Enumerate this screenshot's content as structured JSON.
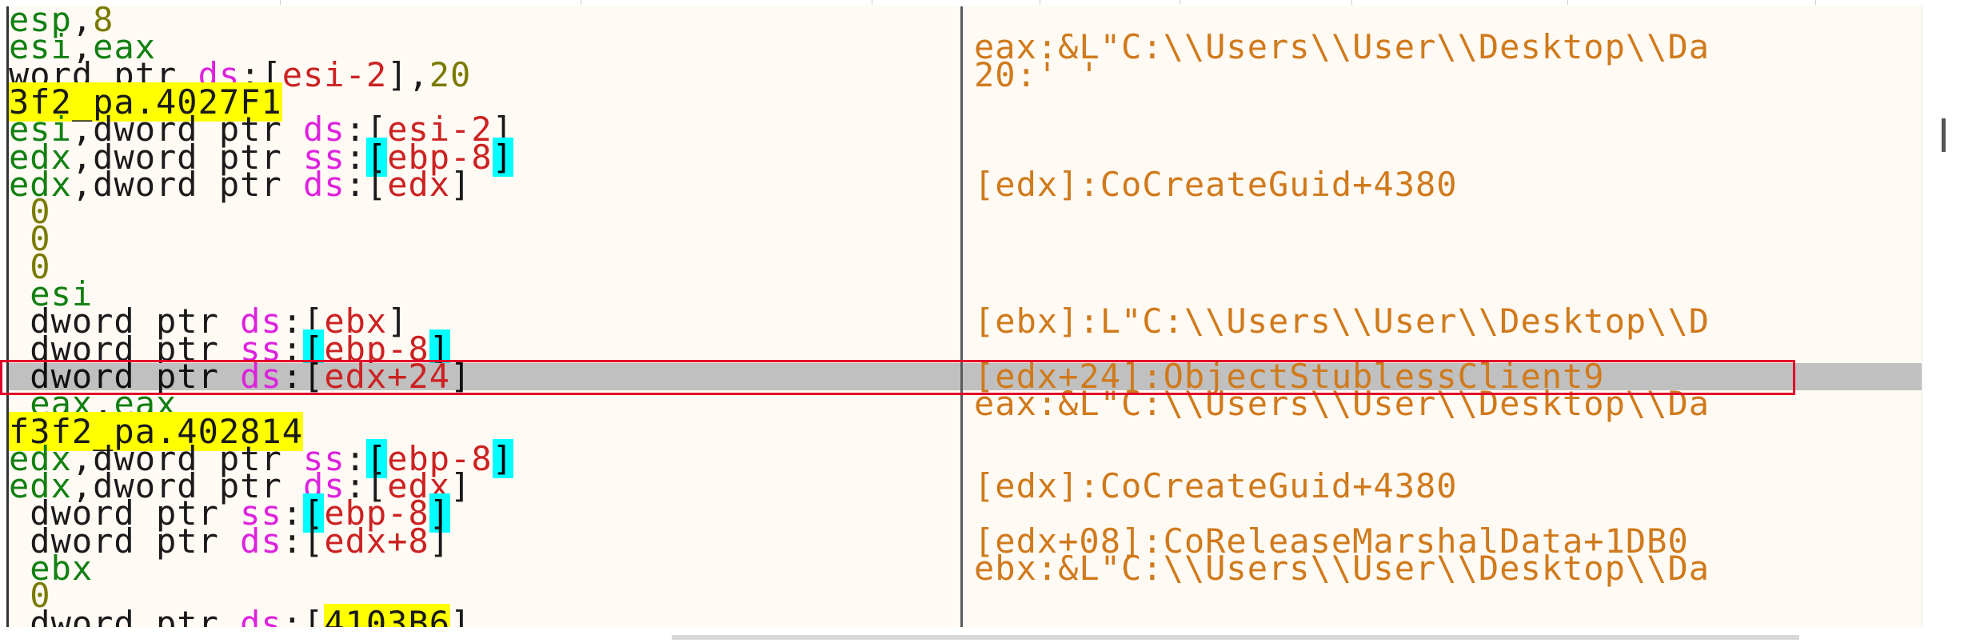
{
  "window": {
    "name": "disassembly-view"
  },
  "rows": [
    {
      "parts": [
        {
          "t": "esp",
          "c": "c-reg"
        },
        {
          "t": ",",
          "c": "c-punct"
        },
        {
          "t": "8",
          "c": "c-num"
        }
      ],
      "comment": ""
    },
    {
      "parts": [
        {
          "t": "esi",
          "c": "c-reg"
        },
        {
          "t": ",",
          "c": "c-punct"
        },
        {
          "t": "eax",
          "c": "c-reg"
        }
      ],
      "comment": "eax:&L\"C:\\\\Users\\\\User\\\\Desktop\\\\Da"
    },
    {
      "parts": [
        {
          "t": "word ptr ",
          "c": "c-kw"
        },
        {
          "t": "ds",
          "c": "c-seg"
        },
        {
          "t": ":[",
          "c": "c-br"
        },
        {
          "t": "esi-2",
          "c": "c-inner"
        },
        {
          "t": "],",
          "c": "c-br"
        },
        {
          "t": "20",
          "c": "c-num"
        }
      ],
      "comment": "20:' '"
    },
    {
      "parts": [
        {
          "t": "3f2_pa.4027F1",
          "c": "c-label"
        }
      ],
      "comment": ""
    },
    {
      "parts": [
        {
          "t": "esi",
          "c": "c-reg"
        },
        {
          "t": ",",
          "c": "c-punct"
        },
        {
          "t": "dword ptr ",
          "c": "c-kw"
        },
        {
          "t": "ds",
          "c": "c-seg"
        },
        {
          "t": ":[",
          "c": "c-br"
        },
        {
          "t": "esi-2",
          "c": "c-inner"
        },
        {
          "t": "]",
          "c": "c-br"
        }
      ],
      "comment": ""
    },
    {
      "parts": [
        {
          "t": "edx",
          "c": "c-reg"
        },
        {
          "t": ",",
          "c": "c-punct"
        },
        {
          "t": "dword ptr ",
          "c": "c-kw"
        },
        {
          "t": "ss",
          "c": "c-seg"
        },
        {
          "t": ":",
          "c": "c-br"
        },
        {
          "t": "[",
          "c": "c-cyan"
        },
        {
          "t": "ebp-8",
          "c": "c-inner"
        },
        {
          "t": "]",
          "c": "c-cyan"
        }
      ],
      "comment": ""
    },
    {
      "parts": [
        {
          "t": "edx",
          "c": "c-reg"
        },
        {
          "t": ",",
          "c": "c-punct"
        },
        {
          "t": "dword ptr ",
          "c": "c-kw"
        },
        {
          "t": "ds",
          "c": "c-seg"
        },
        {
          "t": ":[",
          "c": "c-br"
        },
        {
          "t": "edx",
          "c": "c-inner"
        },
        {
          "t": "]",
          "c": "c-br"
        }
      ],
      "comment": "[edx]:CoCreateGuid+4380"
    },
    {
      "parts": [
        {
          "t": " 0",
          "c": "c-num"
        }
      ],
      "comment": ""
    },
    {
      "parts": [
        {
          "t": " 0",
          "c": "c-num"
        }
      ],
      "comment": ""
    },
    {
      "parts": [
        {
          "t": " 0",
          "c": "c-num"
        }
      ],
      "comment": ""
    },
    {
      "parts": [
        {
          "t": " esi",
          "c": "c-reg"
        }
      ],
      "comment": ""
    },
    {
      "parts": [
        {
          "t": " dword ptr ",
          "c": "c-kw"
        },
        {
          "t": "ds",
          "c": "c-seg"
        },
        {
          "t": ":[",
          "c": "c-br"
        },
        {
          "t": "ebx",
          "c": "c-inner"
        },
        {
          "t": "]",
          "c": "c-br"
        }
      ],
      "comment": "[ebx]:L\"C:\\\\Users\\\\User\\\\Desktop\\\\D"
    },
    {
      "parts": [
        {
          "t": " dword ptr ",
          "c": "c-kw"
        },
        {
          "t": "ss",
          "c": "c-seg"
        },
        {
          "t": ":",
          "c": "c-br"
        },
        {
          "t": "[",
          "c": "c-cyan"
        },
        {
          "t": "ebp-8",
          "c": "c-inner"
        },
        {
          "t": "]",
          "c": "c-cyan"
        }
      ],
      "comment": ""
    },
    {
      "parts": [
        {
          "t": " dword ptr ",
          "c": "c-kw"
        },
        {
          "t": "ds",
          "c": "c-seg"
        },
        {
          "t": ":[",
          "c": "c-br"
        },
        {
          "t": "edx+24",
          "c": "c-inner"
        },
        {
          "t": "]",
          "c": "c-br"
        }
      ],
      "comment": "[edx+24]:ObjectStublessClient9",
      "selected": true
    },
    {
      "parts": [
        {
          "t": " eax",
          "c": "c-reg"
        },
        {
          "t": ",",
          "c": "c-punct"
        },
        {
          "t": "eax",
          "c": "c-reg"
        }
      ],
      "comment": "eax:&L\"C:\\\\Users\\\\User\\\\Desktop\\\\Da"
    },
    {
      "parts": [
        {
          "t": "f3f2_pa.402814",
          "c": "c-label"
        }
      ],
      "comment": ""
    },
    {
      "parts": [
        {
          "t": "edx",
          "c": "c-reg"
        },
        {
          "t": ",",
          "c": "c-punct"
        },
        {
          "t": "dword ptr ",
          "c": "c-kw"
        },
        {
          "t": "ss",
          "c": "c-seg"
        },
        {
          "t": ":",
          "c": "c-br"
        },
        {
          "t": "[",
          "c": "c-cyan"
        },
        {
          "t": "ebp-8",
          "c": "c-inner"
        },
        {
          "t": "]",
          "c": "c-cyan"
        }
      ],
      "comment": ""
    },
    {
      "parts": [
        {
          "t": "edx",
          "c": "c-reg"
        },
        {
          "t": ",",
          "c": "c-punct"
        },
        {
          "t": "dword ptr ",
          "c": "c-kw"
        },
        {
          "t": "ds",
          "c": "c-seg"
        },
        {
          "t": ":[",
          "c": "c-br"
        },
        {
          "t": "edx",
          "c": "c-inner"
        },
        {
          "t": "]",
          "c": "c-br"
        }
      ],
      "comment": "[edx]:CoCreateGuid+4380"
    },
    {
      "parts": [
        {
          "t": " dword ptr ",
          "c": "c-kw"
        },
        {
          "t": "ss",
          "c": "c-seg"
        },
        {
          "t": ":",
          "c": "c-br"
        },
        {
          "t": "[",
          "c": "c-cyan"
        },
        {
          "t": "ebp-8",
          "c": "c-inner"
        },
        {
          "t": "]",
          "c": "c-cyan"
        }
      ],
      "comment": ""
    },
    {
      "parts": [
        {
          "t": " dword ptr ",
          "c": "c-kw"
        },
        {
          "t": "ds",
          "c": "c-seg"
        },
        {
          "t": ":[",
          "c": "c-br"
        },
        {
          "t": "edx+8",
          "c": "c-inner"
        },
        {
          "t": "]",
          "c": "c-br"
        }
      ],
      "comment": "[edx+08]:CoReleaseMarshalData+1DB0"
    },
    {
      "parts": [
        {
          "t": " ebx",
          "c": "c-reg"
        }
      ],
      "comment": "ebx:&L\"C:\\\\Users\\\\User\\\\Desktop\\\\Da"
    },
    {
      "parts": [
        {
          "t": " 0",
          "c": "c-num"
        }
      ],
      "comment": ""
    },
    {
      "parts": [
        {
          "t": " dword ptr ",
          "c": "c-kw"
        },
        {
          "t": "ds",
          "c": "c-seg"
        },
        {
          "t": ":[",
          "c": "c-br"
        },
        {
          "t": "4103B6",
          "c": "c-label"
        },
        {
          "t": "]",
          "c": "c-br"
        }
      ],
      "comment": ""
    }
  ]
}
